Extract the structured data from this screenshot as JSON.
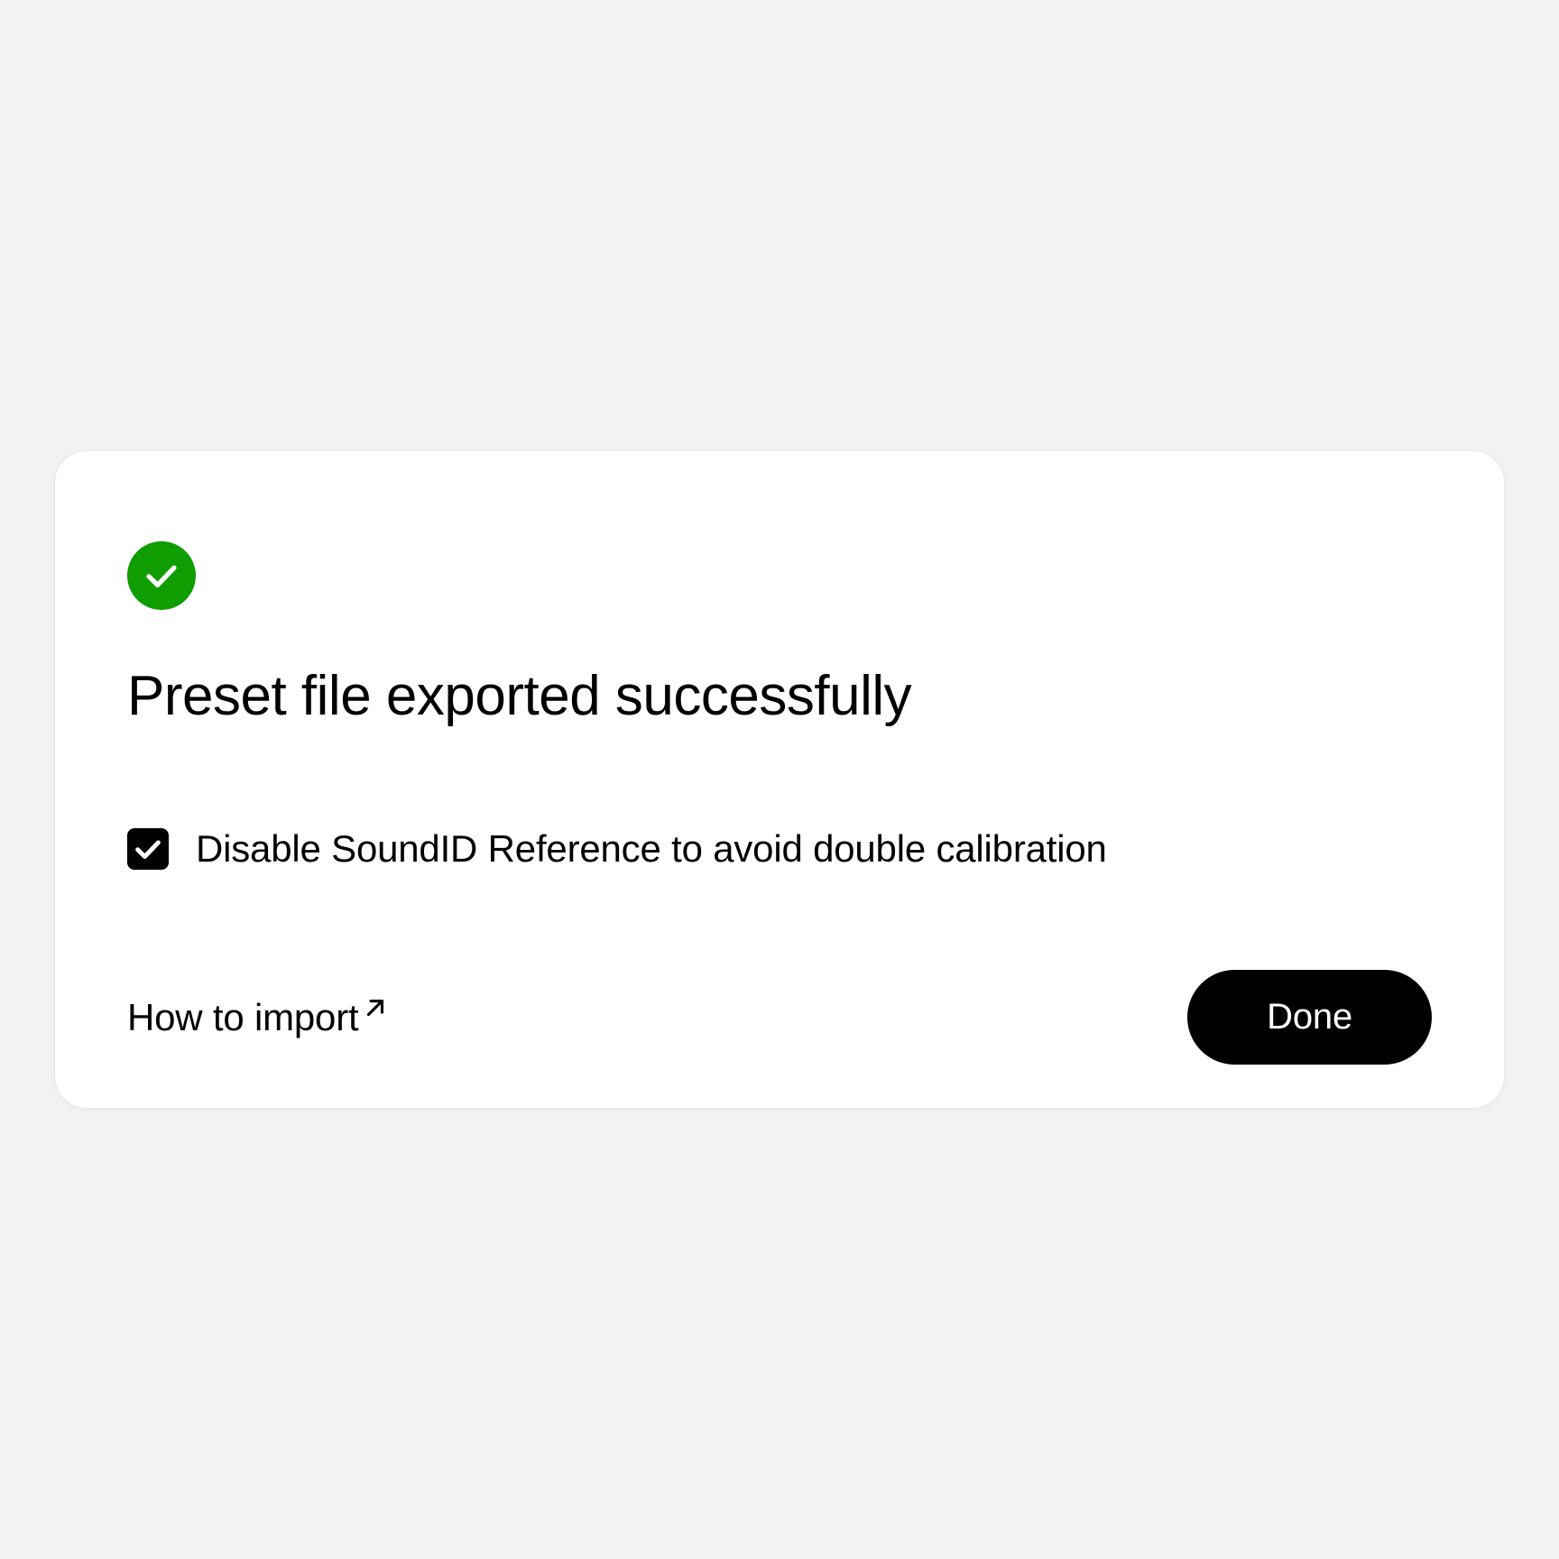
{
  "dialog": {
    "title": "Preset file exported successfully",
    "checkbox_label": "Disable SoundID Reference to avoid double calibration",
    "checkbox_checked": true,
    "import_link_label": "How to import",
    "done_button_label": "Done"
  },
  "colors": {
    "success_green": "#0f9d00",
    "background": "#f2f2f2",
    "card_background": "#ffffff",
    "text_primary": "#000000",
    "button_background": "#000000",
    "button_text": "#ffffff"
  }
}
